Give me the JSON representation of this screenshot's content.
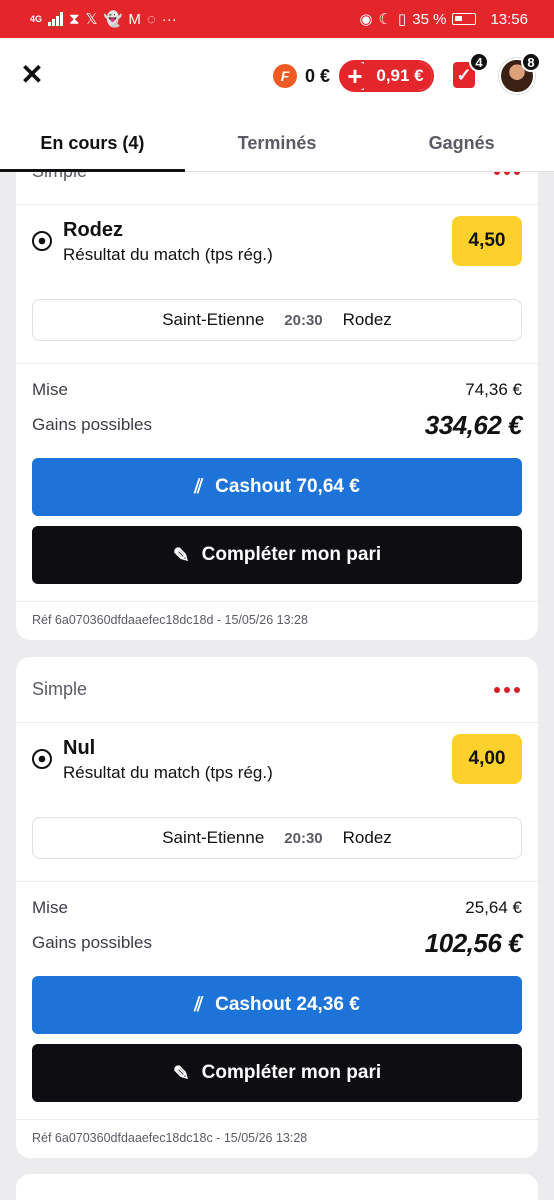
{
  "status_bar": {
    "network": "4G",
    "battery": "35 %",
    "time": "13:56"
  },
  "header": {
    "close_icon": "close-icon",
    "freebet_badge": "F",
    "freebet_value": "0 €",
    "balance_value": "0,91 €",
    "my_bets_count": "4",
    "notifications_count": "8"
  },
  "tabs": [
    {
      "label": "En cours (4)",
      "active": true
    },
    {
      "label": "Terminés",
      "active": false
    },
    {
      "label": "Gagnés",
      "active": false
    }
  ],
  "bets": [
    {
      "type": "Simple",
      "selection": "Rodez",
      "market": "Résultat du match (tps rég.)",
      "odds": "4,50",
      "home_team": "Saint-Etienne",
      "kickoff": "20:30",
      "away_team": "Rodez",
      "stake_label": "Mise",
      "stake": "74,36 €",
      "gains_label": "Gains possibles",
      "gains": "334,62 €",
      "cashout_label": "Cashout 70,64 €",
      "complete_label": "Compléter mon pari",
      "ref": "Réf 6a070360dfdaaefec18dc18d - 15/05/26 13:28"
    },
    {
      "type": "Simple",
      "selection": "Nul",
      "market": "Résultat du match (tps rég.)",
      "odds": "4,00",
      "home_team": "Saint-Etienne",
      "kickoff": "20:30",
      "away_team": "Rodez",
      "stake_label": "Mise",
      "stake": "25,64 €",
      "gains_label": "Gains possibles",
      "gains": "102,56 €",
      "cashout_label": "Cashout 24,36 €",
      "complete_label": "Compléter mon pari",
      "ref": "Réf 6a070360dfdaaefec18dc18c - 15/05/26 13:28"
    }
  ],
  "colors": {
    "brand_red": "#e4262b",
    "odds_yellow": "#fdd12b",
    "cashout_blue": "#1e73d8",
    "complete_black": "#0d0d12"
  }
}
